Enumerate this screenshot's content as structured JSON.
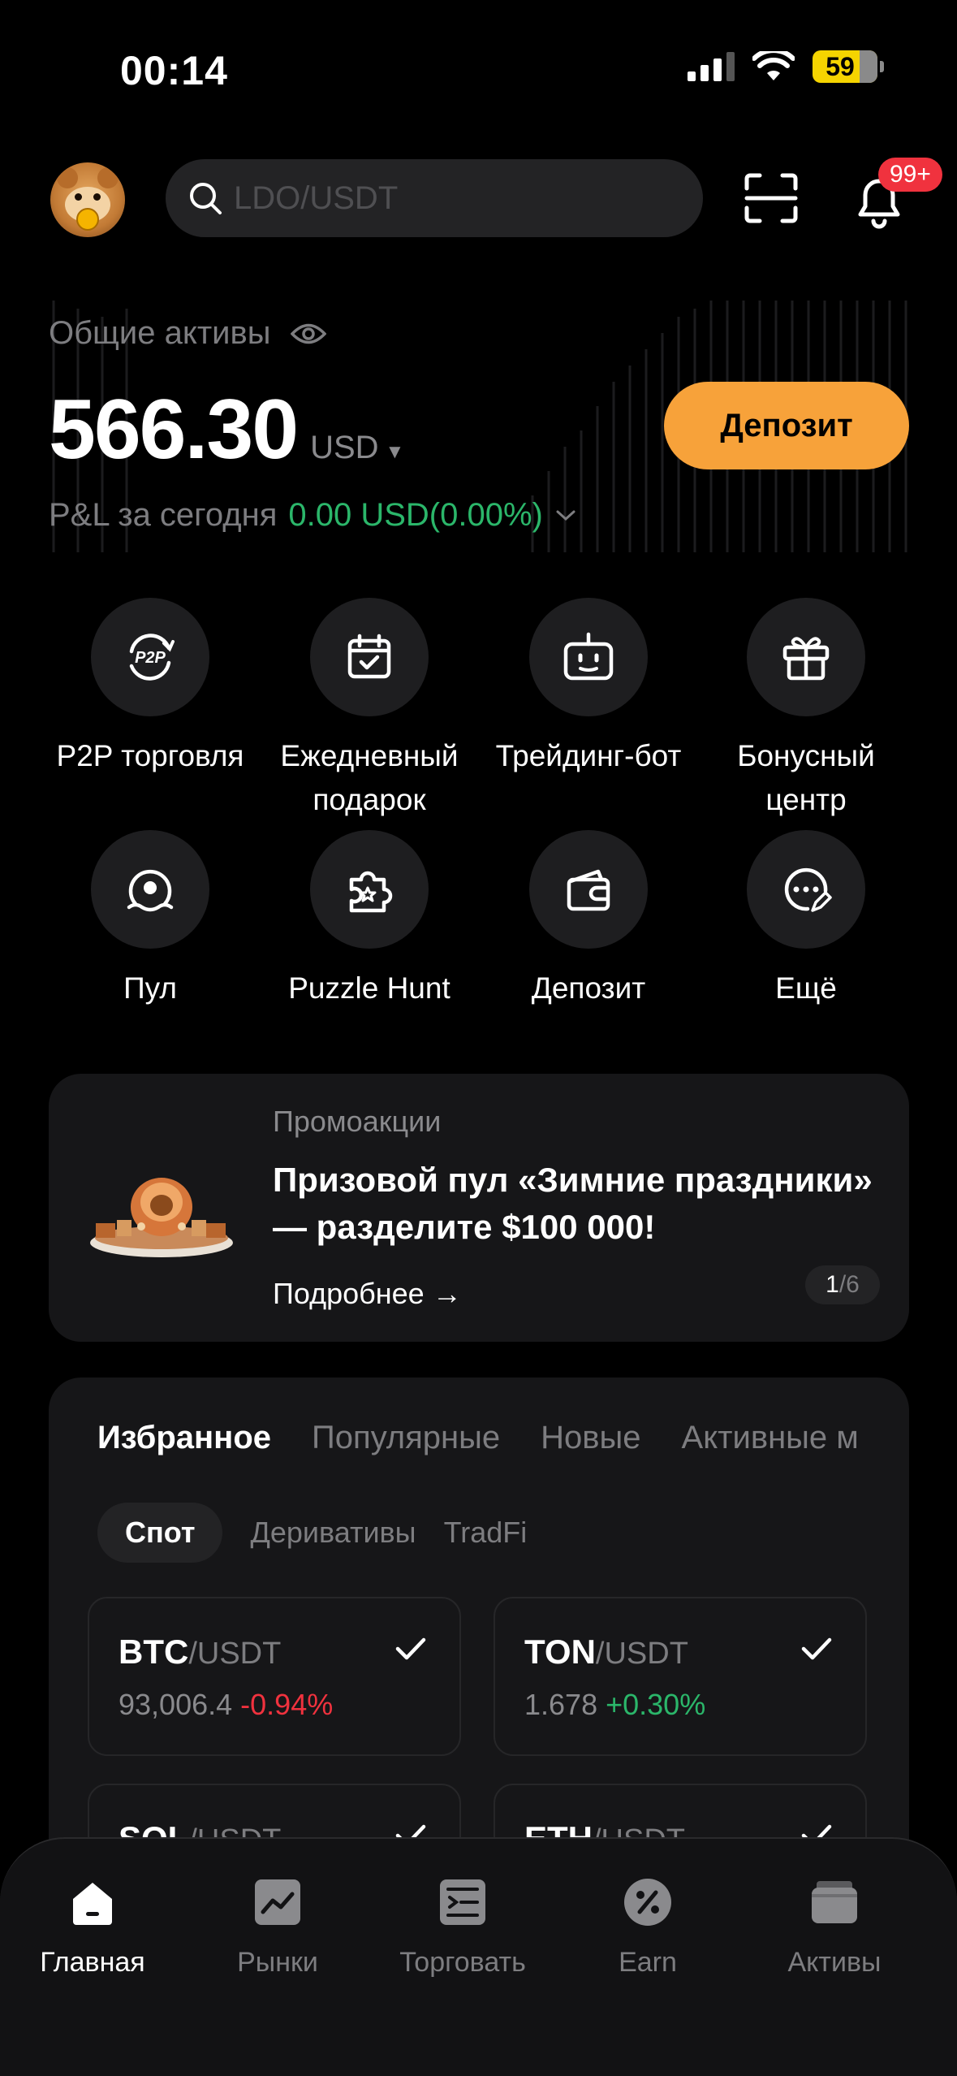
{
  "status_bar": {
    "time": "00:14",
    "battery": "59"
  },
  "header": {
    "search_placeholder": "LDO/USDT",
    "notifications_badge": "99+"
  },
  "assets": {
    "label": "Общие активы",
    "balance": "566.30",
    "currency": "USD",
    "pnl_label": "P&L за сегодня",
    "pnl_value": "0.00 USD(0.00%)",
    "deposit_button": "Депозит"
  },
  "quick_actions": [
    {
      "label": "P2P торговля",
      "icon": "p2p-icon"
    },
    {
      "label": "Ежедневный подарок",
      "icon": "calendar-check-icon"
    },
    {
      "label": "Трейдинг-бот",
      "icon": "robot-icon"
    },
    {
      "label": "Бонусный центр",
      "icon": "gift-icon"
    },
    {
      "label": "Пул",
      "icon": "pool-icon"
    },
    {
      "label": "Puzzle Hunt",
      "icon": "puzzle-icon"
    },
    {
      "label": "Депозит",
      "icon": "wallet-icon"
    },
    {
      "label": "Ещё",
      "icon": "more-icon"
    }
  ],
  "promo": {
    "tag": "Промоакции",
    "title": "Призовой пул «Зимние праздники» — разделите $100 000!",
    "more_link": "Подробнее →",
    "pager_current": "1",
    "pager_total": "/6"
  },
  "markets": {
    "tabs": [
      "Избранное",
      "Популярные",
      "Новые",
      "Активные м"
    ],
    "subtabs": [
      "Спот",
      "Деривативы",
      "TradFi"
    ],
    "pairs": [
      {
        "base": "BTC",
        "quote": "/USDT",
        "price": "93,006.4",
        "change": "-0.94%"
      },
      {
        "base": "TON",
        "quote": "/USDT",
        "price": "1.678",
        "change": "+0.30%"
      },
      {
        "base": "SOL",
        "quote": "/USDT"
      },
      {
        "base": "ETH",
        "quote": "/USDT"
      }
    ]
  },
  "nav": [
    {
      "label": "Главная",
      "icon": "home-icon"
    },
    {
      "label": "Рынки",
      "icon": "markets-icon"
    },
    {
      "label": "Торговать",
      "icon": "trade-icon"
    },
    {
      "label": "Earn",
      "icon": "earn-icon"
    },
    {
      "label": "Активы",
      "icon": "assets-wallet-icon"
    }
  ],
  "colors": {
    "accent": "#f7a23a",
    "positive": "#2bb66a",
    "negative": "#f0323e",
    "badge": "#f0323e"
  }
}
